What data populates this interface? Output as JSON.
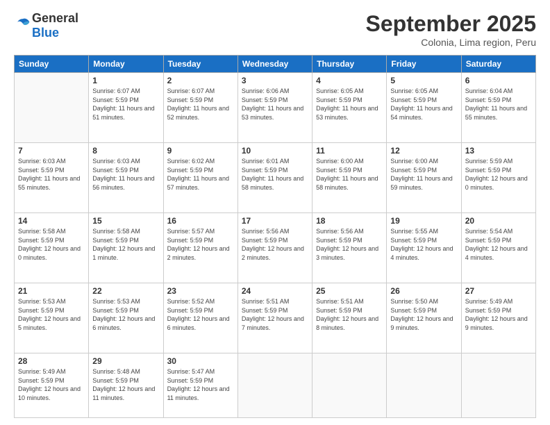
{
  "logo": {
    "general": "General",
    "blue": "Blue"
  },
  "header": {
    "month": "September 2025",
    "location": "Colonia, Lima region, Peru"
  },
  "weekdays": [
    "Sunday",
    "Monday",
    "Tuesday",
    "Wednesday",
    "Thursday",
    "Friday",
    "Saturday"
  ],
  "weeks": [
    [
      {
        "day": "",
        "sunrise": "",
        "sunset": "",
        "daylight": ""
      },
      {
        "day": "1",
        "sunrise": "Sunrise: 6:07 AM",
        "sunset": "Sunset: 5:59 PM",
        "daylight": "Daylight: 11 hours and 51 minutes."
      },
      {
        "day": "2",
        "sunrise": "Sunrise: 6:07 AM",
        "sunset": "Sunset: 5:59 PM",
        "daylight": "Daylight: 11 hours and 52 minutes."
      },
      {
        "day": "3",
        "sunrise": "Sunrise: 6:06 AM",
        "sunset": "Sunset: 5:59 PM",
        "daylight": "Daylight: 11 hours and 53 minutes."
      },
      {
        "day": "4",
        "sunrise": "Sunrise: 6:05 AM",
        "sunset": "Sunset: 5:59 PM",
        "daylight": "Daylight: 11 hours and 53 minutes."
      },
      {
        "day": "5",
        "sunrise": "Sunrise: 6:05 AM",
        "sunset": "Sunset: 5:59 PM",
        "daylight": "Daylight: 11 hours and 54 minutes."
      },
      {
        "day": "6",
        "sunrise": "Sunrise: 6:04 AM",
        "sunset": "Sunset: 5:59 PM",
        "daylight": "Daylight: 11 hours and 55 minutes."
      }
    ],
    [
      {
        "day": "7",
        "sunrise": "Sunrise: 6:03 AM",
        "sunset": "Sunset: 5:59 PM",
        "daylight": "Daylight: 11 hours and 55 minutes."
      },
      {
        "day": "8",
        "sunrise": "Sunrise: 6:03 AM",
        "sunset": "Sunset: 5:59 PM",
        "daylight": "Daylight: 11 hours and 56 minutes."
      },
      {
        "day": "9",
        "sunrise": "Sunrise: 6:02 AM",
        "sunset": "Sunset: 5:59 PM",
        "daylight": "Daylight: 11 hours and 57 minutes."
      },
      {
        "day": "10",
        "sunrise": "Sunrise: 6:01 AM",
        "sunset": "Sunset: 5:59 PM",
        "daylight": "Daylight: 11 hours and 58 minutes."
      },
      {
        "day": "11",
        "sunrise": "Sunrise: 6:00 AM",
        "sunset": "Sunset: 5:59 PM",
        "daylight": "Daylight: 11 hours and 58 minutes."
      },
      {
        "day": "12",
        "sunrise": "Sunrise: 6:00 AM",
        "sunset": "Sunset: 5:59 PM",
        "daylight": "Daylight: 11 hours and 59 minutes."
      },
      {
        "day": "13",
        "sunrise": "Sunrise: 5:59 AM",
        "sunset": "Sunset: 5:59 PM",
        "daylight": "Daylight: 12 hours and 0 minutes."
      }
    ],
    [
      {
        "day": "14",
        "sunrise": "Sunrise: 5:58 AM",
        "sunset": "Sunset: 5:59 PM",
        "daylight": "Daylight: 12 hours and 0 minutes."
      },
      {
        "day": "15",
        "sunrise": "Sunrise: 5:58 AM",
        "sunset": "Sunset: 5:59 PM",
        "daylight": "Daylight: 12 hours and 1 minute."
      },
      {
        "day": "16",
        "sunrise": "Sunrise: 5:57 AM",
        "sunset": "Sunset: 5:59 PM",
        "daylight": "Daylight: 12 hours and 2 minutes."
      },
      {
        "day": "17",
        "sunrise": "Sunrise: 5:56 AM",
        "sunset": "Sunset: 5:59 PM",
        "daylight": "Daylight: 12 hours and 2 minutes."
      },
      {
        "day": "18",
        "sunrise": "Sunrise: 5:56 AM",
        "sunset": "Sunset: 5:59 PM",
        "daylight": "Daylight: 12 hours and 3 minutes."
      },
      {
        "day": "19",
        "sunrise": "Sunrise: 5:55 AM",
        "sunset": "Sunset: 5:59 PM",
        "daylight": "Daylight: 12 hours and 4 minutes."
      },
      {
        "day": "20",
        "sunrise": "Sunrise: 5:54 AM",
        "sunset": "Sunset: 5:59 PM",
        "daylight": "Daylight: 12 hours and 4 minutes."
      }
    ],
    [
      {
        "day": "21",
        "sunrise": "Sunrise: 5:53 AM",
        "sunset": "Sunset: 5:59 PM",
        "daylight": "Daylight: 12 hours and 5 minutes."
      },
      {
        "day": "22",
        "sunrise": "Sunrise: 5:53 AM",
        "sunset": "Sunset: 5:59 PM",
        "daylight": "Daylight: 12 hours and 6 minutes."
      },
      {
        "day": "23",
        "sunrise": "Sunrise: 5:52 AM",
        "sunset": "Sunset: 5:59 PM",
        "daylight": "Daylight: 12 hours and 6 minutes."
      },
      {
        "day": "24",
        "sunrise": "Sunrise: 5:51 AM",
        "sunset": "Sunset: 5:59 PM",
        "daylight": "Daylight: 12 hours and 7 minutes."
      },
      {
        "day": "25",
        "sunrise": "Sunrise: 5:51 AM",
        "sunset": "Sunset: 5:59 PM",
        "daylight": "Daylight: 12 hours and 8 minutes."
      },
      {
        "day": "26",
        "sunrise": "Sunrise: 5:50 AM",
        "sunset": "Sunset: 5:59 PM",
        "daylight": "Daylight: 12 hours and 9 minutes."
      },
      {
        "day": "27",
        "sunrise": "Sunrise: 5:49 AM",
        "sunset": "Sunset: 5:59 PM",
        "daylight": "Daylight: 12 hours and 9 minutes."
      }
    ],
    [
      {
        "day": "28",
        "sunrise": "Sunrise: 5:49 AM",
        "sunset": "Sunset: 5:59 PM",
        "daylight": "Daylight: 12 hours and 10 minutes."
      },
      {
        "day": "29",
        "sunrise": "Sunrise: 5:48 AM",
        "sunset": "Sunset: 5:59 PM",
        "daylight": "Daylight: 12 hours and 11 minutes."
      },
      {
        "day": "30",
        "sunrise": "Sunrise: 5:47 AM",
        "sunset": "Sunset: 5:59 PM",
        "daylight": "Daylight: 12 hours and 11 minutes."
      },
      {
        "day": "",
        "sunrise": "",
        "sunset": "",
        "daylight": ""
      },
      {
        "day": "",
        "sunrise": "",
        "sunset": "",
        "daylight": ""
      },
      {
        "day": "",
        "sunrise": "",
        "sunset": "",
        "daylight": ""
      },
      {
        "day": "",
        "sunrise": "",
        "sunset": "",
        "daylight": ""
      }
    ]
  ]
}
